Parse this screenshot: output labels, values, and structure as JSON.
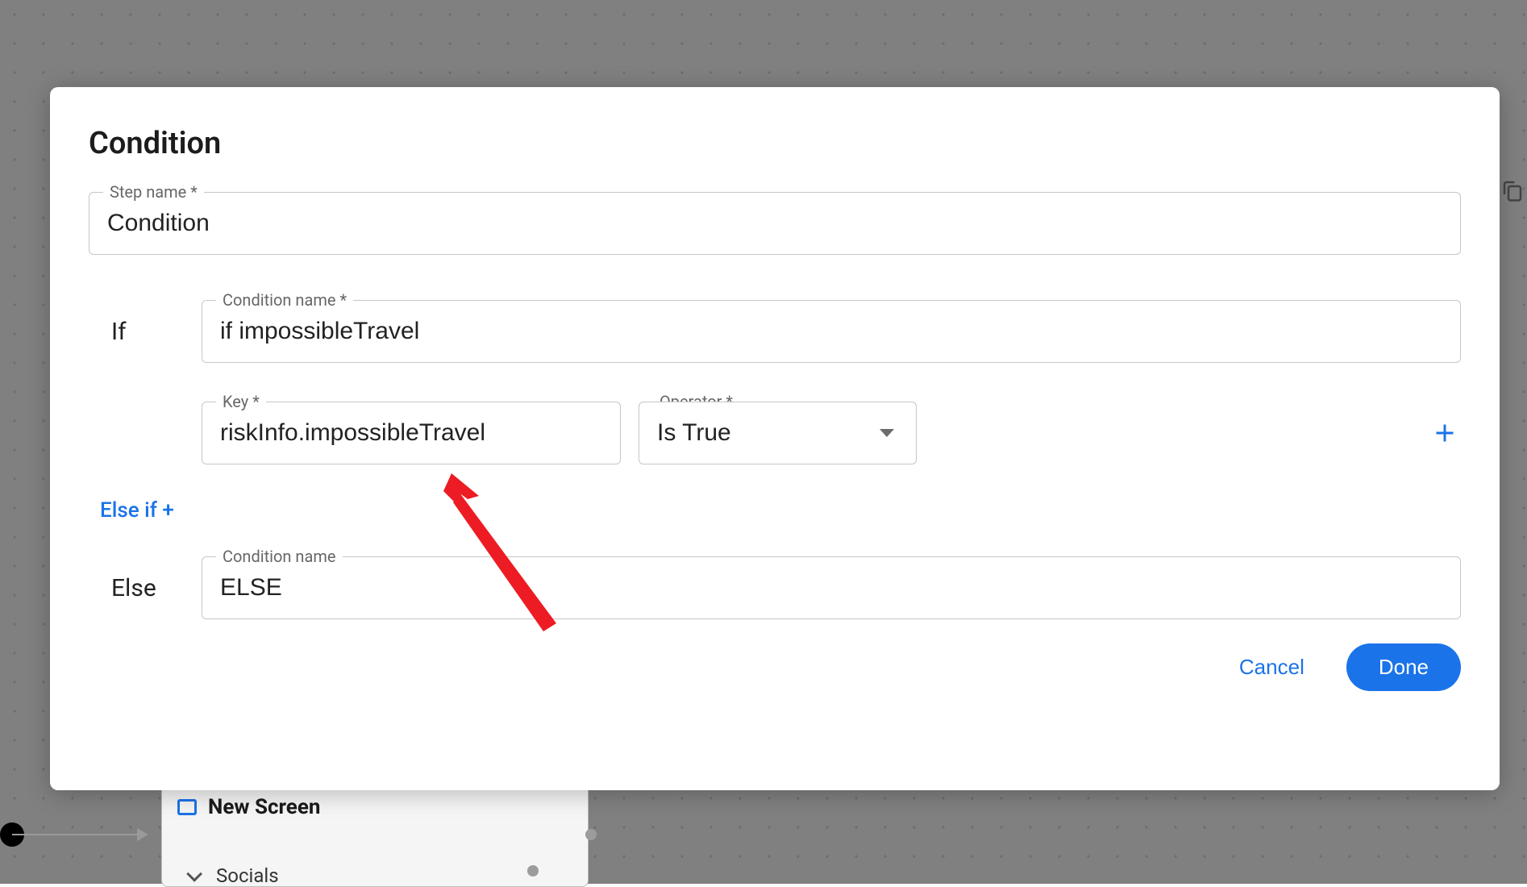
{
  "modal": {
    "title": "Condition",
    "step_name_label": "Step name *",
    "step_name_value": "Condition",
    "if_label": "If",
    "condition_name_label": "Condition name *",
    "condition_name_value": "if impossibleTravel",
    "key_label": "Key *",
    "key_value": "riskInfo.impossibleTravel",
    "operator_label": "Operator *",
    "operator_value": "Is True",
    "elseif_link": "Else if +",
    "else_label": "Else",
    "else_condition_label": "Condition name",
    "else_condition_value": "ELSE",
    "cancel": "Cancel",
    "done": "Done"
  },
  "background": {
    "new_screen": "New Screen",
    "socials": "Socials"
  }
}
